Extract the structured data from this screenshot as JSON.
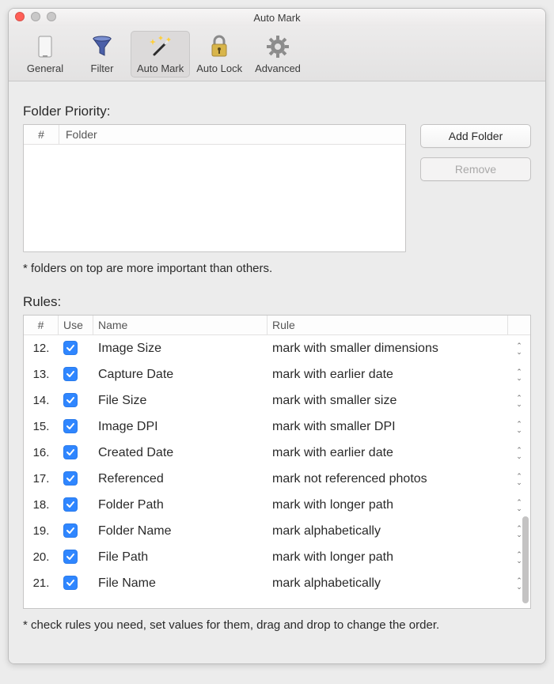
{
  "window": {
    "title": "Auto Mark"
  },
  "toolbar": {
    "tabs": [
      {
        "label": "General"
      },
      {
        "label": "Filter"
      },
      {
        "label": "Auto Mark"
      },
      {
        "label": "Auto Lock"
      },
      {
        "label": "Advanced"
      }
    ],
    "selected_index": 2
  },
  "folder": {
    "section_title": "Folder Priority:",
    "columns": {
      "num": "#",
      "folder": "Folder"
    },
    "add_button": "Add Folder",
    "remove_button": "Remove",
    "hint": "* folders on top are more important than others."
  },
  "rules": {
    "section_title": "Rules:",
    "columns": {
      "num": "#",
      "use": "Use",
      "name": "Name",
      "rule": "Rule"
    },
    "rows": [
      {
        "num": "12.",
        "use": true,
        "name": "Image Size",
        "rule": "mark with smaller dimensions"
      },
      {
        "num": "13.",
        "use": true,
        "name": "Capture Date",
        "rule": "mark with earlier date"
      },
      {
        "num": "14.",
        "use": true,
        "name": "File Size",
        "rule": "mark with smaller size"
      },
      {
        "num": "15.",
        "use": true,
        "name": "Image DPI",
        "rule": "mark with smaller DPI"
      },
      {
        "num": "16.",
        "use": true,
        "name": "Created Date",
        "rule": "mark with earlier date"
      },
      {
        "num": "17.",
        "use": true,
        "name": "Referenced",
        "rule": "mark not referenced photos"
      },
      {
        "num": "18.",
        "use": true,
        "name": "Folder Path",
        "rule": "mark with longer path"
      },
      {
        "num": "19.",
        "use": true,
        "name": "Folder Name",
        "rule": "mark alphabetically"
      },
      {
        "num": "20.",
        "use": true,
        "name": "File Path",
        "rule": "mark with longer path"
      },
      {
        "num": "21.",
        "use": true,
        "name": "File Name",
        "rule": "mark alphabetically"
      }
    ],
    "hint": "* check rules you need, set values for them, drag and drop to change the order."
  }
}
